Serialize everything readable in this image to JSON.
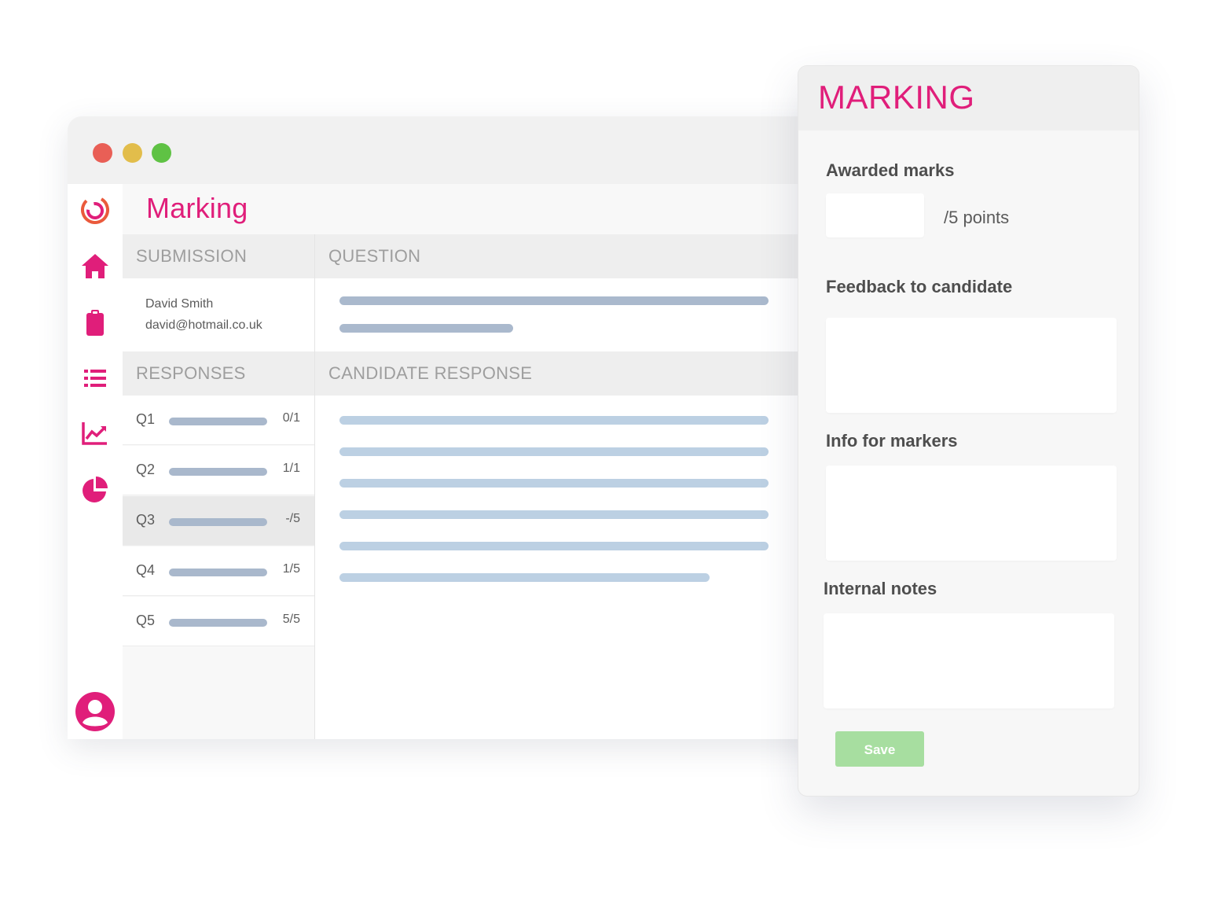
{
  "window": {
    "controls": [
      "close-dot",
      "minimize-dot",
      "maximize-dot"
    ]
  },
  "sidebar": {
    "icons": [
      "logo-icon",
      "home-icon",
      "clipboard-icon",
      "list-icon",
      "analytics-icon",
      "pie-chart-icon",
      "user-avatar-icon"
    ],
    "accent": "#e01e7a"
  },
  "main": {
    "title": "Marking",
    "submission_header": "SUBMISSION",
    "question_header": "QUESTION",
    "responses_header": "RESPONSES",
    "candidate_response_header": "CANDIDATE RESPONSE",
    "submission": {
      "name": "David Smith",
      "email": "david@hotmail.co.uk"
    },
    "responses": [
      {
        "label": "Q1",
        "score": "0/1"
      },
      {
        "label": "Q2",
        "score": "1/1"
      },
      {
        "label": "Q3",
        "score": "-/5"
      },
      {
        "label": "Q4",
        "score": "1/5"
      },
      {
        "label": "Q5",
        "score": "5/5"
      }
    ],
    "selected_response": "Q3"
  },
  "panel": {
    "title": "MARKING",
    "awarded_marks_label": "Awarded marks",
    "awarded_marks_value": "",
    "points_suffix": "/5 points",
    "feedback_label": "Feedback to candidate",
    "info_label": "Info for markers",
    "notes_label": "Internal notes",
    "save_label": "Save",
    "save_color": "#a7dea0"
  }
}
